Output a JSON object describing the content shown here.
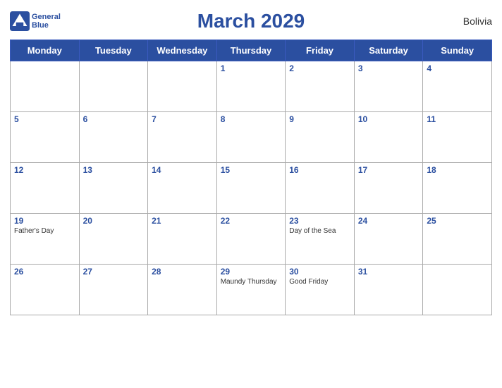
{
  "header": {
    "title": "March 2029",
    "country": "Bolivia"
  },
  "logo": {
    "line1": "General",
    "line2": "Blue"
  },
  "weekdays": [
    "Monday",
    "Tuesday",
    "Wednesday",
    "Thursday",
    "Friday",
    "Saturday",
    "Sunday"
  ],
  "weeks": [
    [
      {
        "day": null,
        "events": []
      },
      {
        "day": null,
        "events": []
      },
      {
        "day": null,
        "events": []
      },
      {
        "day": "1",
        "events": []
      },
      {
        "day": "2",
        "events": []
      },
      {
        "day": "3",
        "events": []
      },
      {
        "day": "4",
        "events": []
      }
    ],
    [
      {
        "day": "5",
        "events": []
      },
      {
        "day": "6",
        "events": []
      },
      {
        "day": "7",
        "events": []
      },
      {
        "day": "8",
        "events": []
      },
      {
        "day": "9",
        "events": []
      },
      {
        "day": "10",
        "events": []
      },
      {
        "day": "11",
        "events": []
      }
    ],
    [
      {
        "day": "12",
        "events": []
      },
      {
        "day": "13",
        "events": []
      },
      {
        "day": "14",
        "events": []
      },
      {
        "day": "15",
        "events": []
      },
      {
        "day": "16",
        "events": []
      },
      {
        "day": "17",
        "events": []
      },
      {
        "day": "18",
        "events": []
      }
    ],
    [
      {
        "day": "19",
        "events": [
          "Father's Day"
        ]
      },
      {
        "day": "20",
        "events": []
      },
      {
        "day": "21",
        "events": []
      },
      {
        "day": "22",
        "events": []
      },
      {
        "day": "23",
        "events": [
          "Day of the Sea"
        ]
      },
      {
        "day": "24",
        "events": []
      },
      {
        "day": "25",
        "events": []
      }
    ],
    [
      {
        "day": "26",
        "events": []
      },
      {
        "day": "27",
        "events": []
      },
      {
        "day": "28",
        "events": []
      },
      {
        "day": "29",
        "events": [
          "Maundy Thursday"
        ]
      },
      {
        "day": "30",
        "events": [
          "Good Friday"
        ]
      },
      {
        "day": "31",
        "events": []
      },
      {
        "day": null,
        "events": []
      }
    ]
  ]
}
